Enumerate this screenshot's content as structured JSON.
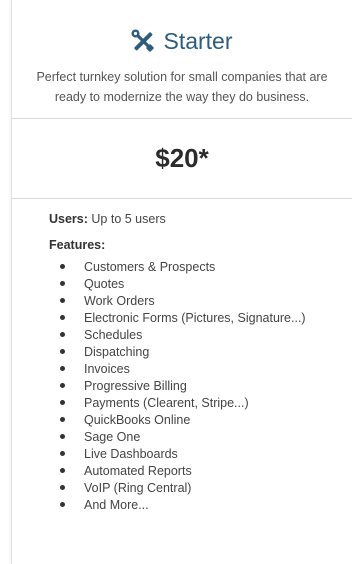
{
  "plan": {
    "title": "Starter",
    "icon": "tools-icon",
    "description": "Perfect turnkey solution for small companies that are ready to modernize the way they do business.",
    "price": "$20*",
    "users_label": "Users:",
    "users_value": "Up to 5 users",
    "features_label": "Features:",
    "features": [
      "Customers & Prospects",
      "Quotes",
      "Work Orders",
      "Electronic Forms (Pictures, Signature...)",
      "Schedules",
      "Dispatching",
      "Invoices",
      "Progressive Billing",
      "Payments (Clearent, Stripe...)",
      "QuickBooks Online",
      "Sage One",
      "Live Dashboards",
      "Automated Reports",
      "VoIP (Ring Central)",
      "And More..."
    ]
  },
  "colors": {
    "title": "#2c5d7d",
    "text": "#444444"
  }
}
